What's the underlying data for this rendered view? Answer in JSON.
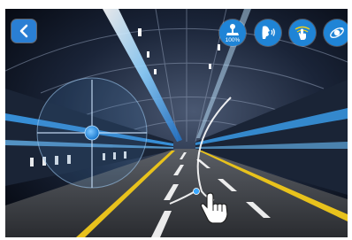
{
  "controls": {
    "back_icon": "chevron-left-icon",
    "joystick_mode": {
      "icon": "joystick-icon",
      "value_label": "100%"
    },
    "voice_control": {
      "icon": "voice-control-icon"
    },
    "gesture_control": {
      "icon": "hand-gesture-icon"
    },
    "gravity_sensor": {
      "icon": "gyroscope-icon"
    }
  },
  "colors": {
    "button_blue": "#1f84d6",
    "accent_cyan": "#3aa8ff",
    "road_yellow": "#e8c21c"
  }
}
